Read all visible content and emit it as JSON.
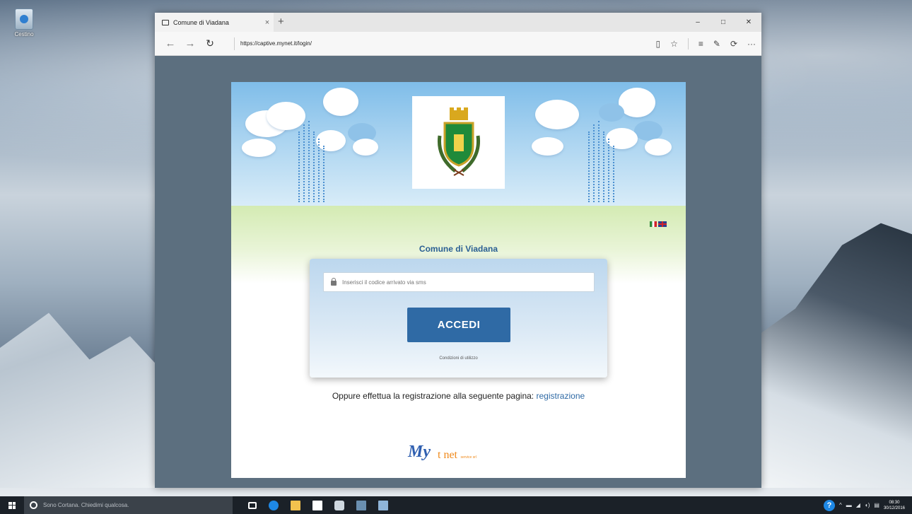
{
  "desktop": {
    "recycle_bin_label": "Cestino"
  },
  "browser": {
    "tab_title": "Comune di Viadana",
    "tab_close": "×",
    "new_tab": "+",
    "url": "https://captive.mynet.it/login/",
    "controls": {
      "minimize": "–",
      "maximize": "□",
      "close": "✕"
    },
    "nav": {
      "back": "←",
      "forward": "→",
      "refresh": "↻"
    },
    "toolbar": {
      "reading": "▯",
      "favorite": "☆",
      "hub": "≡",
      "notes": "✎",
      "share": "⟳",
      "more": "···"
    }
  },
  "page": {
    "org_title": "Comune di Viadana",
    "code_placeholder": "Inserisci il codice arrivato via sms",
    "login_button": "ACCEDI",
    "conditions_link": "Condizioni di utilizzo",
    "register_text": "Oppure effettua la registrazione alla seguente pagina: ",
    "register_link": "registrazione",
    "footer": {
      "my": "My",
      "tnet": "t net",
      "tnet_sub": "service srl"
    }
  },
  "taskbar": {
    "search_placeholder": "Sono Cortana. Chiedimi qualcosa.",
    "clock_time": "08:30",
    "clock_date": "30/12/2016",
    "help_icon": "?"
  },
  "colors": {
    "accent": "#2f6aa5",
    "title": "#2a5f93",
    "taskbar": "#1b2128"
  }
}
